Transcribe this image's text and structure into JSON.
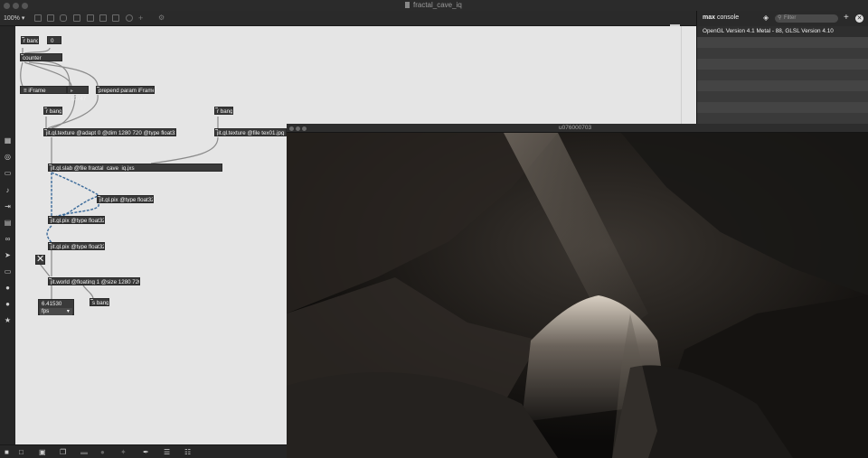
{
  "window": {
    "title": "fractal_cave_iq"
  },
  "toolbar": {
    "zoom_label": "100% ▾"
  },
  "patch": {
    "objects": {
      "r_bang_1": "r bang",
      "zero": "0",
      "counter": "counter",
      "iframe_label": "iFrame",
      "iframe_value": "10747",
      "prepend": "prepend param iFrame",
      "r_bang_2": "r bang",
      "r_bang_3": "r bang",
      "texture_adapt": "jit.gl.texture @adapt 0 @dim 1280 720 @type float32",
      "texture_file": "jit.gl.texture @file tex01.jpg @",
      "slab": "jit.gl.slab @file fractal_cave_iq.jxs",
      "pix_1": "jit.gl.pix @type float32",
      "pix_2": "jit.gl.pix @type float32",
      "pix_3": "jit.gl.pix @type float32",
      "toggle": "✕",
      "world": "jit.world @floating 1 @size 1280 720",
      "fps_value": "6.41530",
      "fps_unit": "fps",
      "s_bang": "s bang"
    }
  },
  "console": {
    "title_bold": "max",
    "title_rest": " console",
    "filter_placeholder": "Filter",
    "message": "OpenGL Version 4.1 Metal - 88, GLSL Version 4.10"
  },
  "viewer": {
    "title": "u076000703"
  },
  "colors": {
    "canvas": "#e5e5e5",
    "object": "#3a3a3a",
    "patchcord": "#8a8a8a",
    "signal_cord": "#3a6a9a"
  }
}
